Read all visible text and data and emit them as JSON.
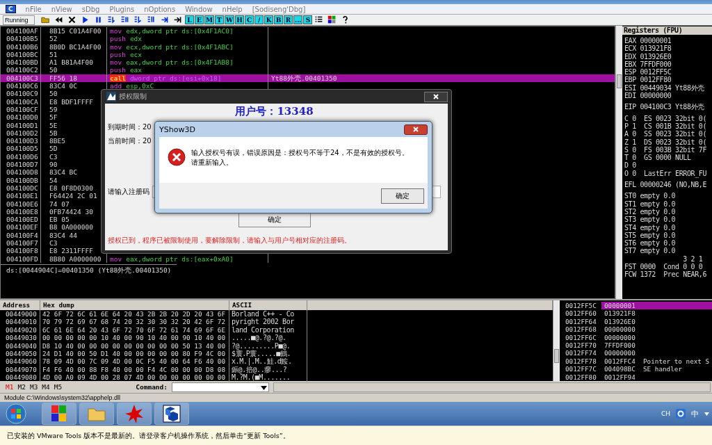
{
  "menubar": {
    "logo": "C",
    "items": [
      "nFile",
      "nView",
      "sDbg",
      "Plugins",
      "nOptions",
      "Window",
      "nHelp",
      "[Sodiseng'Dbg]"
    ]
  },
  "toolbar": {
    "status": "Running",
    "letter_buttons": [
      "L",
      "E",
      "M",
      "T",
      "W",
      "H",
      "C",
      "/",
      "K",
      "B",
      "R",
      "...",
      "S"
    ]
  },
  "disassembly": {
    "rows": [
      {
        "address": "004100AF",
        "hex": "8B15 C01A4F00",
        "disasm": {
          "mnemonic": "mov",
          "operands": "edx,dword ptr ds:[0x4F1AC0]"
        },
        "comment": "",
        "selected": false
      },
      {
        "address": "004100B5",
        "hex": "52",
        "disasm": {
          "mnemonic": "push",
          "operands": "edx"
        },
        "comment": "",
        "selected": false
      },
      {
        "address": "004100B6",
        "hex": "8B0D BC1A4F00",
        "disasm": {
          "mnemonic": "mov",
          "operands": "ecx,dword ptr ds:[0x4F1ABC]"
        },
        "comment": "",
        "selected": false
      },
      {
        "address": "004100BC",
        "hex": "51",
        "disasm": {
          "mnemonic": "push",
          "operands": "ecx"
        },
        "comment": "",
        "selected": false
      },
      {
        "address": "004100BD",
        "hex": "A1 B81A4F00",
        "disasm": {
          "mnemonic": "mov",
          "operands": "eax,dword ptr ds:[0x4F1AB8]"
        },
        "comment": "",
        "selected": false
      },
      {
        "address": "004100C2",
        "hex": "50",
        "disasm": {
          "mnemonic": "push",
          "operands": "eax"
        },
        "comment": "",
        "selected": false
      },
      {
        "address": "004100C3",
        "hex": "FF56 18",
        "disasm": {
          "mnemonic": "call",
          "operands": "dword ptr ds:[esi+0x18]"
        },
        "comment": "Yt88外壳.00401350",
        "selected": true
      },
      {
        "address": "004100C6",
        "hex": "83C4 0C",
        "disasm": {
          "mnemonic": "add",
          "operands": "esp,0xC"
        },
        "comment": "",
        "selected": false
      },
      {
        "address": "004100C9",
        "hex": "50",
        "comment": "",
        "selected": false
      },
      {
        "address": "004100CA",
        "hex": "E8 BDF1FFFF",
        "comment": "",
        "selected": false
      },
      {
        "address": "004100CF",
        "hex": "59",
        "comment": "",
        "selected": false
      },
      {
        "address": "004100D0",
        "hex": "5F",
        "comment": "",
        "selected": false
      },
      {
        "address": "004100D1",
        "hex": "5E",
        "comment": "",
        "selected": false
      },
      {
        "address": "004100D2",
        "hex": "5B",
        "comment": "",
        "selected": false
      },
      {
        "address": "004100D3",
        "hex": "8BE5",
        "comment": "",
        "selected": false
      },
      {
        "address": "004100D5",
        "hex": "5D",
        "comment": "",
        "selected": false
      },
      {
        "address": "004100D6",
        "hex": "C3",
        "comment": "",
        "selected": false
      },
      {
        "address": "004100D7",
        "hex": "90",
        "comment": "",
        "selected": false
      },
      {
        "address": "004100D8",
        "hex": "83C4 BC",
        "comment": "",
        "selected": false
      },
      {
        "address": "004100DB",
        "hex": "54",
        "comment": "",
        "selected": false
      },
      {
        "address": "004100DC",
        "hex": "E8 0F8D0300",
        "comment": "",
        "selected": false
      },
      {
        "address": "004100E1",
        "hex": "F64424 2C 01",
        "comment": "",
        "selected": false
      },
      {
        "address": "004100E6",
        "hex": "74 07",
        "comment": "",
        "selected": false
      },
      {
        "address": "004100E8",
        "hex": "0FB74424 30",
        "comment": "",
        "selected": false
      },
      {
        "address": "004100ED",
        "hex": "EB 05",
        "comment": "",
        "selected": false
      },
      {
        "address": "004100EF",
        "hex": "B8 0A000000",
        "comment": "",
        "selected": false
      },
      {
        "address": "004100F4",
        "hex": "83C4 44",
        "comment": "",
        "selected": false
      },
      {
        "address": "004100F7",
        "hex": "C3",
        "comment": "",
        "selected": false
      },
      {
        "address": "004100F8",
        "hex": "E8 2311FFFF",
        "comment": "",
        "selected": false
      },
      {
        "address": "004100FD",
        "hex": "8B80 A0000000",
        "disasm": {
          "mnemonic": "mov",
          "operands": "eax,dword ptr ds:[eax+0xA0]"
        },
        "comment": "",
        "selected": false
      }
    ],
    "info_line": "ds:[0044904C]=00401350 (Yt88外壳.00401350)"
  },
  "registers": {
    "title": "Registers (FPU)",
    "groups": [
      [
        "EAX 00000001",
        "ECX 013921F8",
        "EDX 013926E0",
        "EBX 7FFDF000",
        "ESP 0012FF5C",
        "EBP 0012FF80",
        "ESI 00449034 Yt88外壳",
        "EDI 00000000"
      ],
      [
        "EIP 004100C3 Yt88外壳"
      ],
      [
        "C 0  ES 0023 32bit 0(",
        "P 1  CS 001B 32bit 0(",
        "A 0  SS 0023 32bit 0(",
        "Z 1  DS 0023 32bit 0(",
        "S 0  FS 003B 32bit 7F",
        "T 0  GS 0000 NULL",
        "D 0",
        "O 0  LastErr ERROR_FU"
      ],
      [
        "EFL 00000246 (NO,NB,E"
      ],
      [
        "ST0 empty 0.0",
        "ST1 empty 0.0",
        "ST2 empty 0.0",
        "ST3 empty 0.0",
        "ST4 empty 0.0",
        "ST5 empty 0.0",
        "ST6 empty 0.0",
        "ST7 empty 0.0",
        "               3 2 1",
        "FST 0000  Cond 0 0 0",
        "FCW 1372  Prec NEAR,6"
      ]
    ]
  },
  "hex_dump": {
    "columns": [
      "Address",
      "Hex dump",
      "ASCII"
    ],
    "rows": [
      {
        "address": "00449000",
        "hex": "42 6F 72 6C 61 6E 64 20 43 2B 2B 20 2D 20 43 6F",
        "ascii": "Borland C++ - Co"
      },
      {
        "address": "00449010",
        "hex": "70 79 72 69 67 68 74 20 32 30 30 32 20 42 6F 72",
        "ascii": "pyright 2002 Bor"
      },
      {
        "address": "00449020",
        "hex": "6C 61 6E 64 20 43 6F 72 70 6F 72 61 74 69 6F 6E",
        "ascii": "land Corporation"
      },
      {
        "address": "00449030",
        "hex": "00 00 00 00 00 10 40 00 90 10 40 00 90 10 40 00",
        "ascii": ".....■@.?@.?@."
      },
      {
        "address": "00449040",
        "hex": "D8 10 40 00 00 00 00 00 00 00 00 00 50 13 40 00",
        "ascii": "?@.........P■@."
      },
      {
        "address": "00449050",
        "hex": "24 D1 40 00 50 D1 40 00 00 00 00 00 80 F9 4C 00",
        "ascii": "$寰.P寰.....■鶴."
      },
      {
        "address": "00449060",
        "hex": "78 09 4D 00 7C 09 4D 00 0C F5 40 00 64 F6 40 00",
        "ascii": "x.M.|.M..鮭.d鮟."
      },
      {
        "address": "00449070",
        "hex": "F4 F6 40 00 88 F8 40 00 00 F4 4C 00 00 00 D8 08",
        "ascii": "鋠@.掊@..瘳...?"
      },
      {
        "address": "00449080",
        "hex": "4D 00 A0 09 4D 00 28 07 4D 00 00 00 00 00 00 00",
        "ascii": "M.?M.(■M......."
      }
    ]
  },
  "stack": {
    "rows": [
      {
        "address": "0012FF5C",
        "value": "00000001",
        "comment": "",
        "selected": true
      },
      {
        "address": "0012FF60",
        "value": "013921F8",
        "comment": "",
        "selected": false
      },
      {
        "address": "0012FF64",
        "value": "013926E0",
        "comment": "",
        "selected": false
      },
      {
        "address": "0012FF68",
        "value": "00000000",
        "comment": "",
        "selected": false
      },
      {
        "address": "0012FF6C",
        "value": "00000000",
        "comment": "",
        "selected": false
      },
      {
        "address": "0012FF70",
        "value": "7FFDF000",
        "comment": "",
        "selected": false
      },
      {
        "address": "0012FF74",
        "value": "00000000",
        "comment": "",
        "selected": false
      },
      {
        "address": "0012FF78",
        "value": "0012FFC4",
        "comment": "Pointer to next S",
        "selected": false
      },
      {
        "address": "0012FF7C",
        "value": "004098BC",
        "comment": "SE handler",
        "selected": false
      },
      {
        "address": "0012FF80",
        "value": "0012FF94",
        "comment": "",
        "selected": false
      }
    ]
  },
  "command_bar": {
    "tabs": [
      {
        "label": "M1",
        "selected": true
      },
      {
        "label": "M2",
        "selected": false
      },
      {
        "label": "M3",
        "selected": false
      },
      {
        "label": "M4",
        "selected": false
      },
      {
        "label": "M5",
        "selected": false
      }
    ],
    "label": "Command:"
  },
  "status_bar": "Module C:\\Windows\\system32\\apphelp.dll",
  "taskbar": {
    "tray": {
      "language": "CH",
      "ime": "中"
    }
  },
  "notice_bar": "已安装的 VMware Tools 版本不是最新的。请登录客户机操作系统，然后单击“更新 Tools”。",
  "license_dialog": {
    "title": "授权限制",
    "user_id": "用户号：13348",
    "expiry_label": "到期时间：20",
    "current_label": "当前时间：20",
    "code_label": "请输入注册码",
    "ok_button": "确定",
    "warning": "授权已到，程序已被限制使用，要解除限制，请输入与用户号相对应的注册码。"
  },
  "message_box": {
    "title": "YShow3D",
    "message": [
      "输入授权号有误，错误原因是：授权号不等于24，不是有效的授权号。",
      "请重新输入。"
    ],
    "ok_button": "确定"
  }
}
